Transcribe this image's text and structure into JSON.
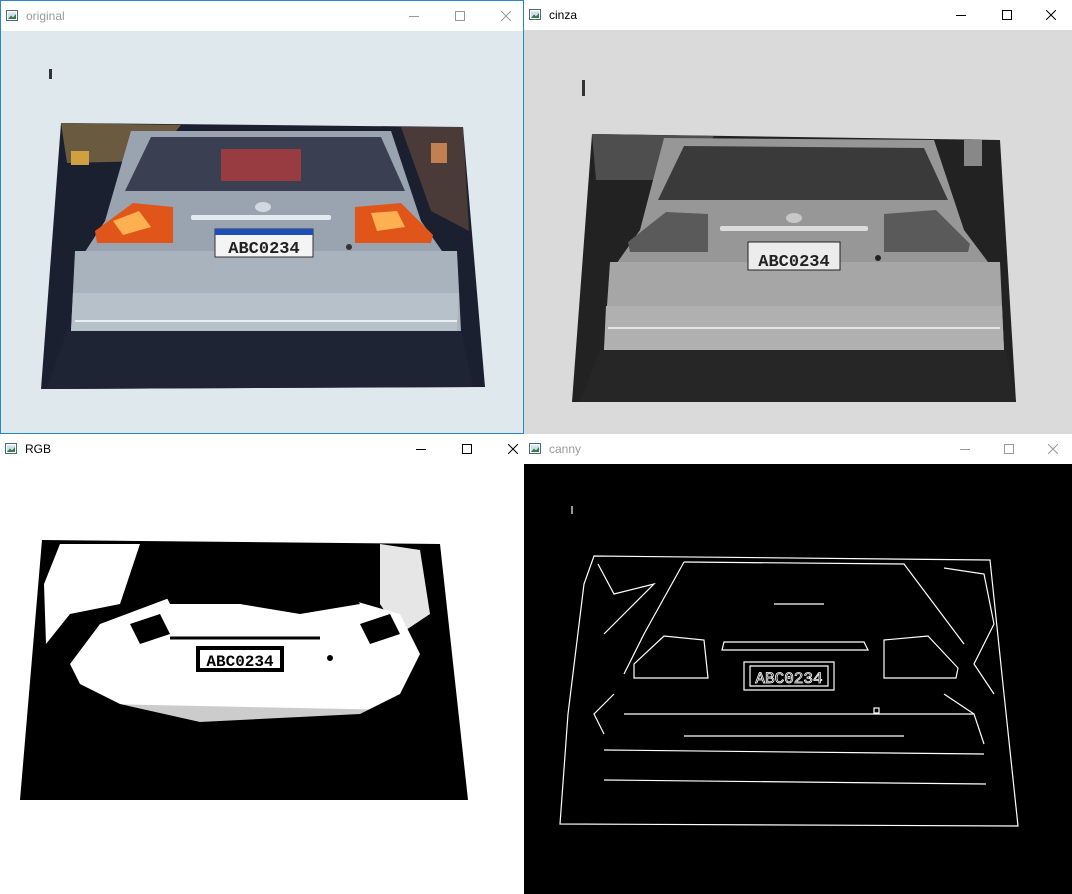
{
  "windows": [
    {
      "id": "original",
      "title": "original",
      "active": true
    },
    {
      "id": "cinza",
      "title": "cinza",
      "active": false
    },
    {
      "id": "rgb",
      "title": "RGB",
      "active": false
    },
    {
      "id": "canny",
      "title": "canny",
      "active": false
    }
  ],
  "plate_text": "ABC0234",
  "icons": {
    "app": "opencv-window-icon",
    "minimize": "minimize-icon",
    "maximize": "maximize-icon",
    "close": "close-icon"
  },
  "colors": {
    "active_border": "#2b86c8",
    "inactive_title": "#999999",
    "taillight": "#e0561a",
    "plate_blue": "#1d4fb8"
  }
}
